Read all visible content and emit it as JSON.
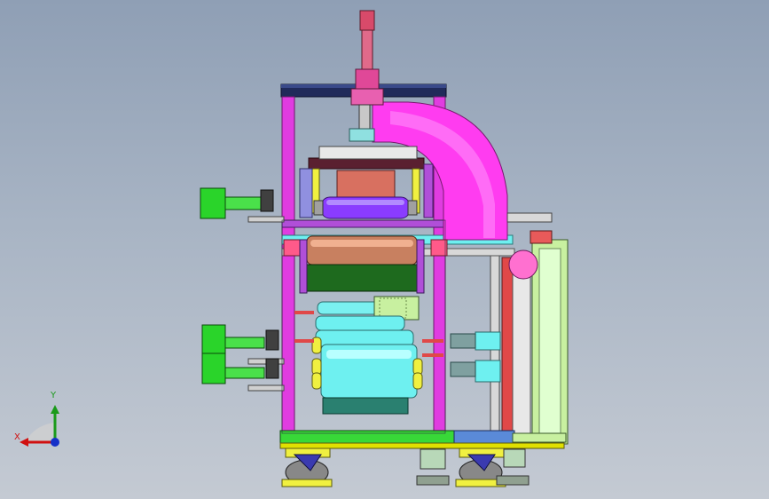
{
  "view": {
    "background_top": "#8f9fb5",
    "background_bottom": "#c4cad3"
  },
  "triad": {
    "x_label": "X",
    "y_label": "Y",
    "x_color": "#d01010",
    "y_color": "#1a9a1a",
    "z_color": "#1530c8"
  },
  "colors": {
    "frame_magenta": "#e03ce0",
    "frame_violet": "#b04fd8",
    "duct_pink": "#ff3cf0",
    "roller_cyan": "#6ef0f0",
    "roller_copper": "#c88060",
    "roller_darkgreen": "#1e6a1e",
    "roller_purple": "#8a3cff",
    "motor_green": "#2ad42a",
    "base_green": "#38d838",
    "top_navy": "#202a5a",
    "rail_red": "#e04848",
    "yellow_part": "#f0f040"
  }
}
